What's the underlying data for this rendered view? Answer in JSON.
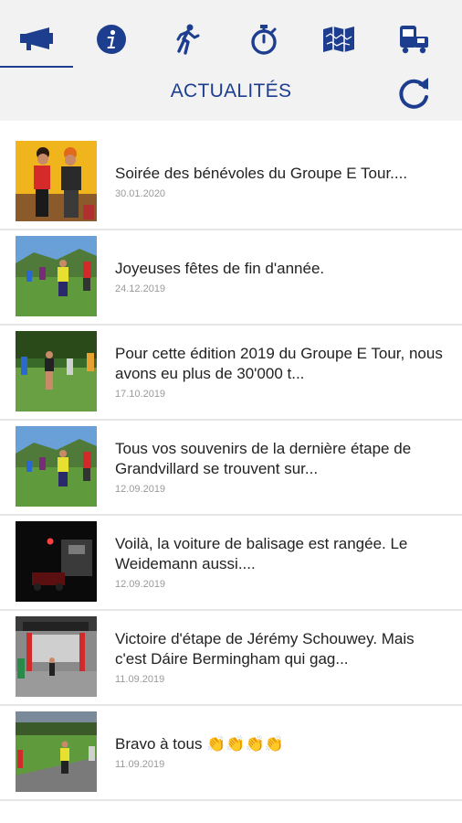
{
  "header": {
    "title": "ACTUALITÉS",
    "tabs": [
      {
        "icon": "megaphone-icon"
      },
      {
        "icon": "info-icon"
      },
      {
        "icon": "runner-icon"
      },
      {
        "icon": "stopwatch-icon"
      },
      {
        "icon": "map-icon"
      },
      {
        "icon": "vehicle-icon"
      }
    ],
    "active_tab": 0,
    "accent_color": "#1d3e8f",
    "refresh_icon": "refresh-icon"
  },
  "news": [
    {
      "title": "Soirée des bénévoles du Groupe E Tour....",
      "date": "30.01.2020"
    },
    {
      "title": "Joyeuses fêtes de fin d'année.",
      "date": "24.12.2019"
    },
    {
      "title": "Pour cette édition 2019 du Groupe E Tour, nous avons eu plus de 30'000 t...",
      "date": "17.10.2019"
    },
    {
      "title": "Tous vos souvenirs de la dernière étape de Grandvillard se trouvent sur...",
      "date": "12.09.2019"
    },
    {
      "title": "Voilà, la voiture de balisage est rangée. Le Weidemann aussi....",
      "date": "12.09.2019"
    },
    {
      "title": "Victoire d'étape de Jérémy Schouwey. Mais c'est Dáire Bermingham qui gag...",
      "date": "11.09.2019"
    },
    {
      "title": "Bravo à tous 👏👏👏👏",
      "date": "11.09.2019"
    }
  ]
}
